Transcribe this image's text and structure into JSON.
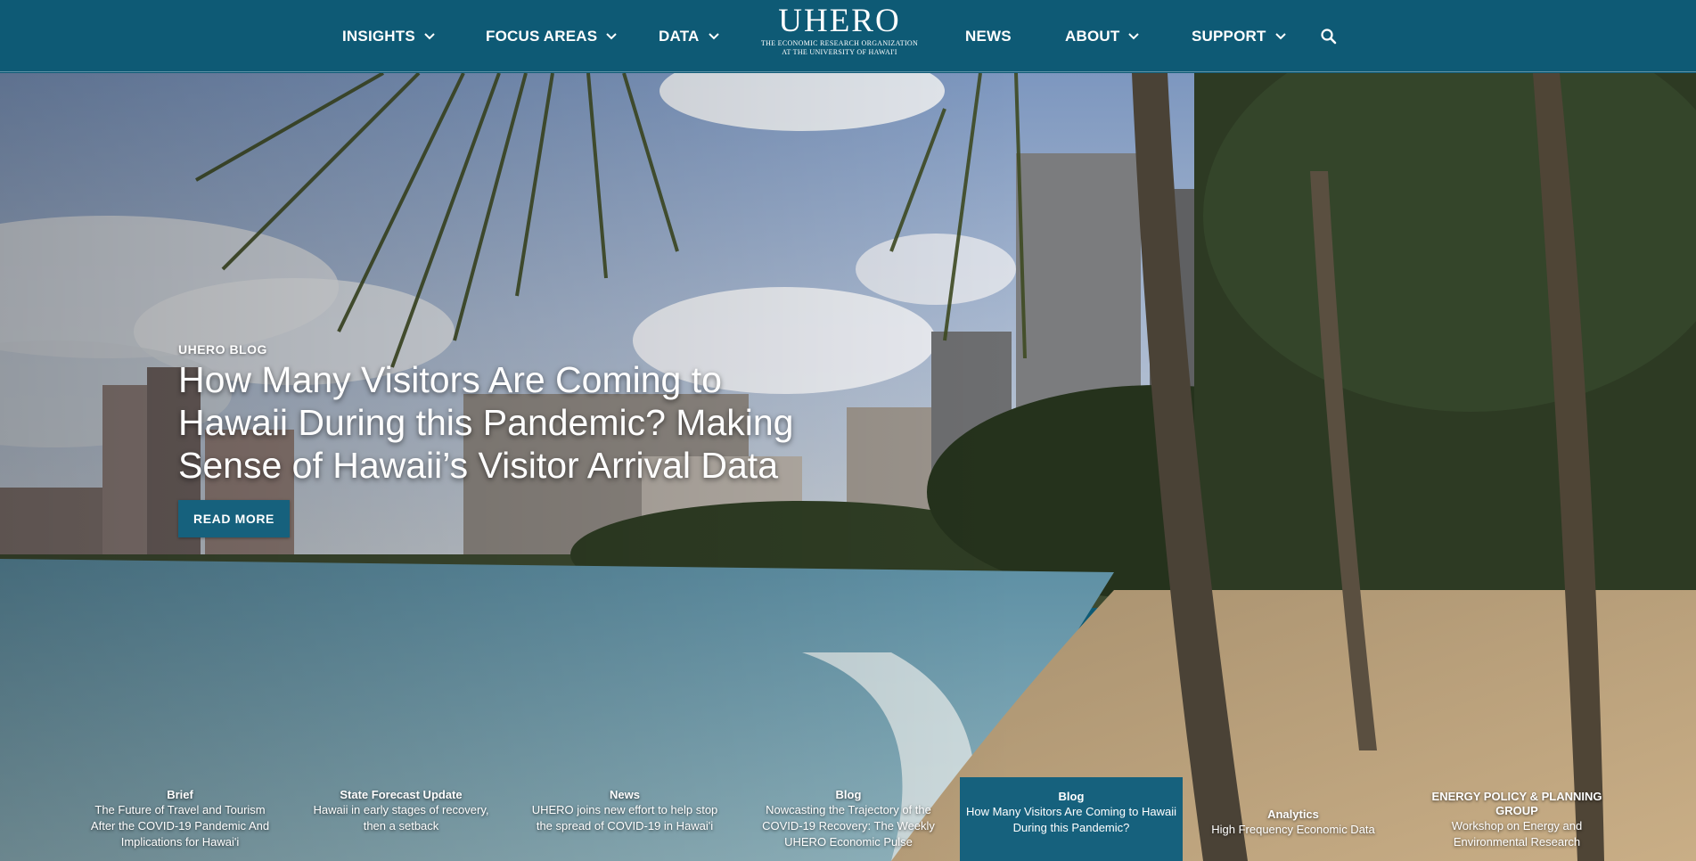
{
  "colors": {
    "nav_bg": "#0e5a75",
    "button_bg": "#16617d",
    "text": "#ffffff"
  },
  "nav": {
    "items": [
      {
        "label": "INSIGHTS",
        "has_dropdown": true
      },
      {
        "label": "FOCUS AREAS",
        "has_dropdown": true
      },
      {
        "label": "DATA",
        "has_dropdown": true
      },
      {
        "label": "NEWS",
        "has_dropdown": false
      },
      {
        "label": "ABOUT",
        "has_dropdown": true
      },
      {
        "label": "SUPPORT",
        "has_dropdown": true
      }
    ],
    "logo": {
      "word": "UHERO",
      "line1": "THE ECONOMIC RESEARCH ORGANIZATION",
      "line2": "AT THE UNIVERSITY OF HAWAI'I"
    },
    "search_icon": "search-icon"
  },
  "hero": {
    "kicker": "UHERO BLOG",
    "title": "How Many Visitors Are Coming to Hawaii During this Pandemic? Making Sense of Hawaii’s Visitor Arrival Data",
    "button": "READ MORE"
  },
  "carousel": [
    {
      "category": "Brief",
      "title": "The Future of Travel and Tourism After the COVID-19 Pandemic And Implications for Hawai'i",
      "active": false
    },
    {
      "category": "State Forecast Update",
      "title": "Hawaii in early stages of recovery, then a setback",
      "active": false
    },
    {
      "category": "News",
      "title": "UHERO joins new effort to help stop the spread of COVID-19 in Hawai'i",
      "active": false
    },
    {
      "category": "Blog",
      "title": "Nowcasting the Trajectory of the COVID-19 Recovery: The Weekly UHERO Economic Pulse",
      "active": false
    },
    {
      "category": "Blog",
      "title": "How Many Visitors Are Coming to Hawaii During this Pandemic?",
      "active": true
    },
    {
      "category": "Analytics",
      "title": "High Frequency Economic Data",
      "active": false
    },
    {
      "category": "ENERGY POLICY & PLANNING GROUP",
      "title": "Workshop on Energy and Environmental Research",
      "active": false
    }
  ]
}
